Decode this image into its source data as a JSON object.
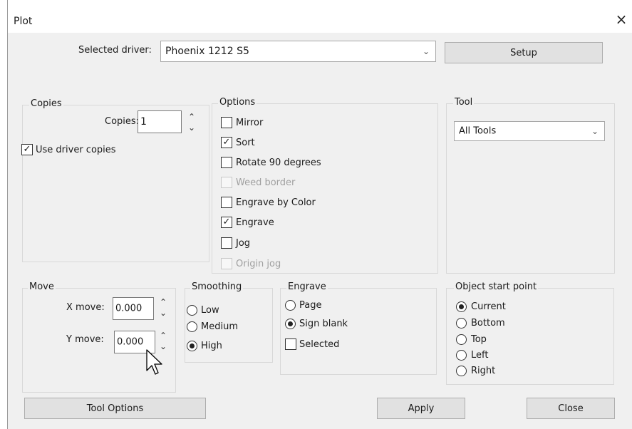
{
  "window": {
    "title": "Plot",
    "close_glyph": "×"
  },
  "driver": {
    "label": "Selected driver:",
    "value": "Phoenix 1212 S5",
    "setup_label": "Setup"
  },
  "copies": {
    "group_title": "Copies",
    "label": "Copies:",
    "value": "1",
    "use_driver_copies_label": "Use driver copies",
    "use_driver_copies_checked": true
  },
  "options": {
    "group_title": "Options",
    "items": [
      {
        "label": "Mirror",
        "checked": false,
        "disabled": false
      },
      {
        "label": "Sort",
        "checked": true,
        "disabled": false
      },
      {
        "label": "Rotate 90 degrees",
        "checked": false,
        "disabled": false
      },
      {
        "label": "Weed border",
        "checked": false,
        "disabled": true
      },
      {
        "label": "Engrave by Color",
        "checked": false,
        "disabled": false
      },
      {
        "label": "Engrave",
        "checked": true,
        "disabled": false
      },
      {
        "label": "Jog",
        "checked": false,
        "disabled": false
      },
      {
        "label": "Origin jog",
        "checked": false,
        "disabled": true
      }
    ]
  },
  "tool": {
    "group_title": "Tool",
    "value": "All Tools"
  },
  "move": {
    "group_title": "Move",
    "x_label": "X move:",
    "x_value": "0.000",
    "y_label": "Y move:",
    "y_value": "0.000"
  },
  "smoothing": {
    "group_title": "Smoothing",
    "options": [
      {
        "label": "Low",
        "selected": false
      },
      {
        "label": "Medium",
        "selected": false
      },
      {
        "label": "High",
        "selected": true
      }
    ]
  },
  "engrave": {
    "group_title": "Engrave",
    "options": [
      {
        "label": "Page",
        "selected": false
      },
      {
        "label": "Sign blank",
        "selected": true
      }
    ],
    "selected_label": "Selected",
    "selected_checked": false
  },
  "start_point": {
    "group_title": "Object start point",
    "options": [
      {
        "label": "Current",
        "selected": true
      },
      {
        "label": "Bottom",
        "selected": false
      },
      {
        "label": "Top",
        "selected": false
      },
      {
        "label": "Left",
        "selected": false
      },
      {
        "label": "Right",
        "selected": false
      }
    ]
  },
  "buttons": {
    "tool_options": "Tool Options",
    "apply": "Apply",
    "close": "Close"
  },
  "icons": {
    "dropdown": "chevron-down-icon",
    "spin_up": "chevron-up-icon",
    "spin_down": "chevron-down-icon",
    "check": "check-icon",
    "cursor": "mouse-pointer-icon"
  }
}
